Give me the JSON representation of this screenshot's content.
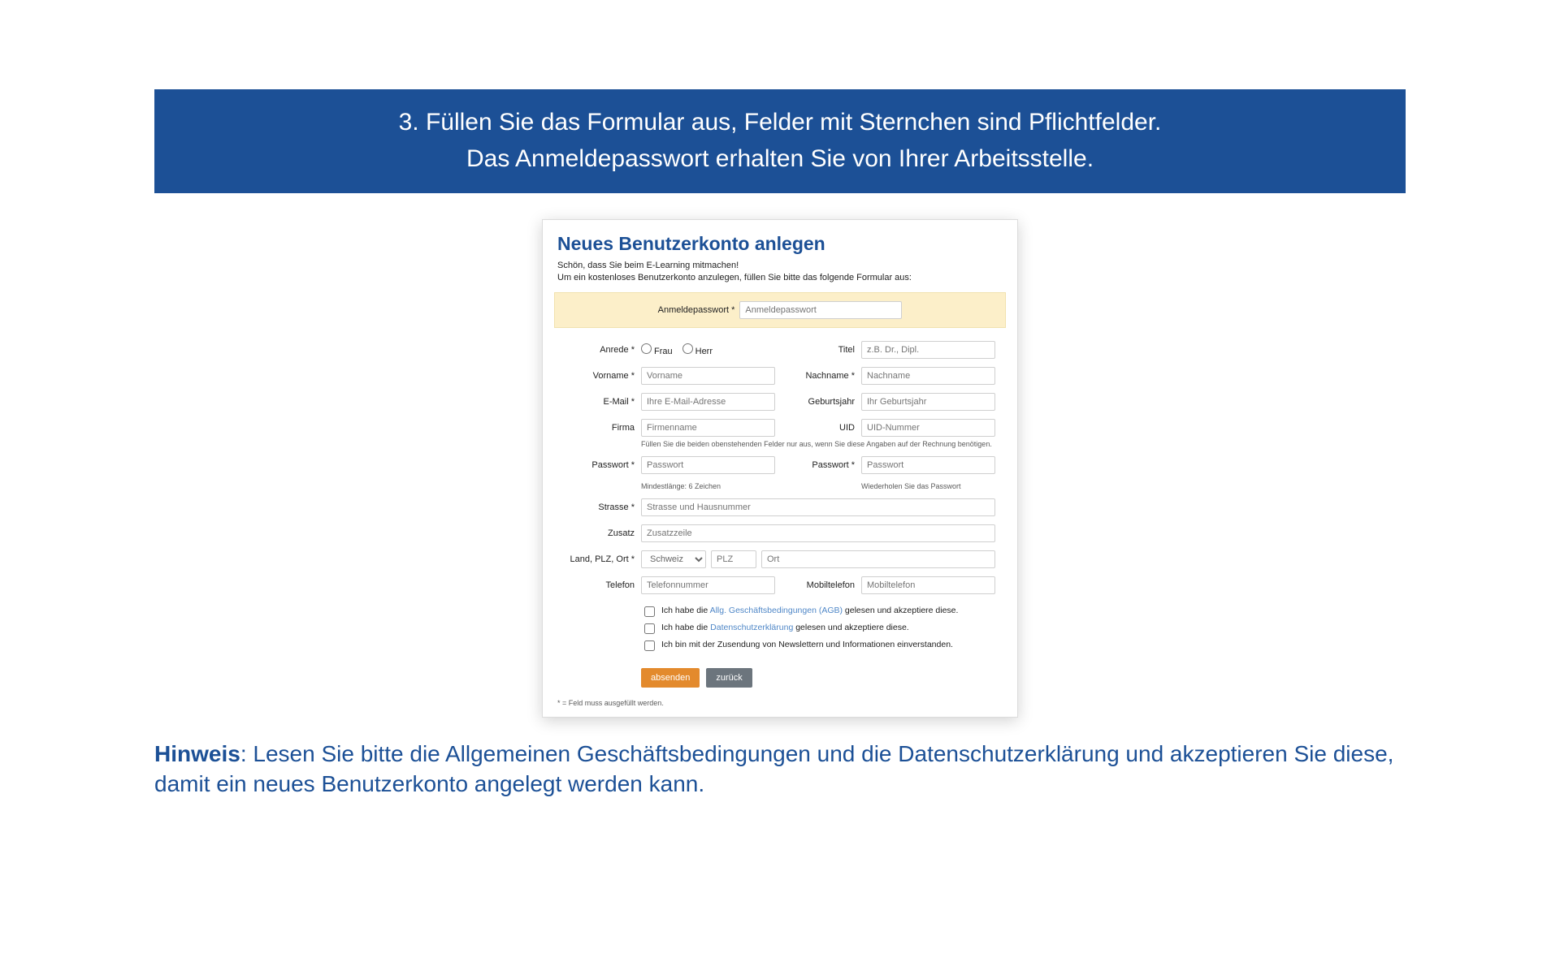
{
  "banner": {
    "line1": "3. Füllen Sie das Formular aus, Felder mit Sternchen sind Pflichtfelder.",
    "line2": "Das Anmeldepasswort erhalten Sie von Ihrer Arbeitsstelle."
  },
  "form": {
    "title": "Neues Benutzerkonto anlegen",
    "intro1": "Schön, dass Sie beim E-Learning mitmachen!",
    "intro2": "Um ein kostenloses Benutzerkonto anzulegen, füllen Sie bitte das folgende Formular aus:",
    "anmeldepasswort_label": "Anmeldepasswort *",
    "anmeldepasswort_ph": "Anmeldepasswort",
    "anrede_label": "Anrede *",
    "anrede_frau": "Frau",
    "anrede_herr": "Herr",
    "titel_label": "Titel",
    "titel_ph": "z.B. Dr., Dipl.",
    "vorname_label": "Vorname *",
    "vorname_ph": "Vorname",
    "nachname_label": "Nachname *",
    "nachname_ph": "Nachname",
    "email_label": "E-Mail *",
    "email_ph": "Ihre E-Mail-Adresse",
    "geburtsjahr_label": "Geburtsjahr",
    "geburtsjahr_ph": "Ihr Geburtsjahr",
    "firma_label": "Firma",
    "firma_ph": "Firmenname",
    "uid_label": "UID",
    "uid_ph": "UID-Nummer",
    "firma_note": "Füllen Sie die beiden obenstehenden Felder nur aus, wenn Sie diese Angaben auf der Rechnung benötigen.",
    "passwort_label": "Passwort *",
    "passwort_ph": "Passwort",
    "passwort_hint_left": "Mindestlänge: 6 Zeichen",
    "passwort2_label": "Passwort *",
    "passwort2_ph": "Passwort",
    "passwort_hint_right": "Wiederholen Sie das Passwort",
    "strasse_label": "Strasse *",
    "strasse_ph": "Strasse und Hausnummer",
    "zusatz_label": "Zusatz",
    "zusatz_ph": "Zusatzzeile",
    "lpo_label": "Land, PLZ, Ort *",
    "land_value": "Schweiz",
    "plz_ph": "PLZ",
    "ort_ph": "Ort",
    "telefon_label": "Telefon",
    "telefon_ph": "Telefonnummer",
    "mobil_label": "Mobiltelefon",
    "mobil_ph": "Mobiltelefon",
    "cb_agb_pre": "Ich habe die ",
    "cb_agb_link": "Allg. Geschäftsbedingungen (AGB)",
    "cb_agb_post": " gelesen und akzeptiere diese.",
    "cb_ds_pre": "Ich habe die ",
    "cb_ds_link": "Datenschutzerklärung",
    "cb_ds_post": " gelesen und akzeptiere diese.",
    "cb_news": "Ich bin mit der Zusendung von Newslettern und Informationen einverstanden.",
    "submit": "absenden",
    "back": "zurück",
    "footnote": "* = Feld muss ausgefüllt werden."
  },
  "bottom": {
    "strong": "Hinweis",
    "text": ": Lesen Sie bitte die Allgemeinen Geschäftsbedingungen und die Datenschutzerklärung und akzeptieren Sie diese, damit ein neues Benutzerkonto angelegt werden kann."
  }
}
